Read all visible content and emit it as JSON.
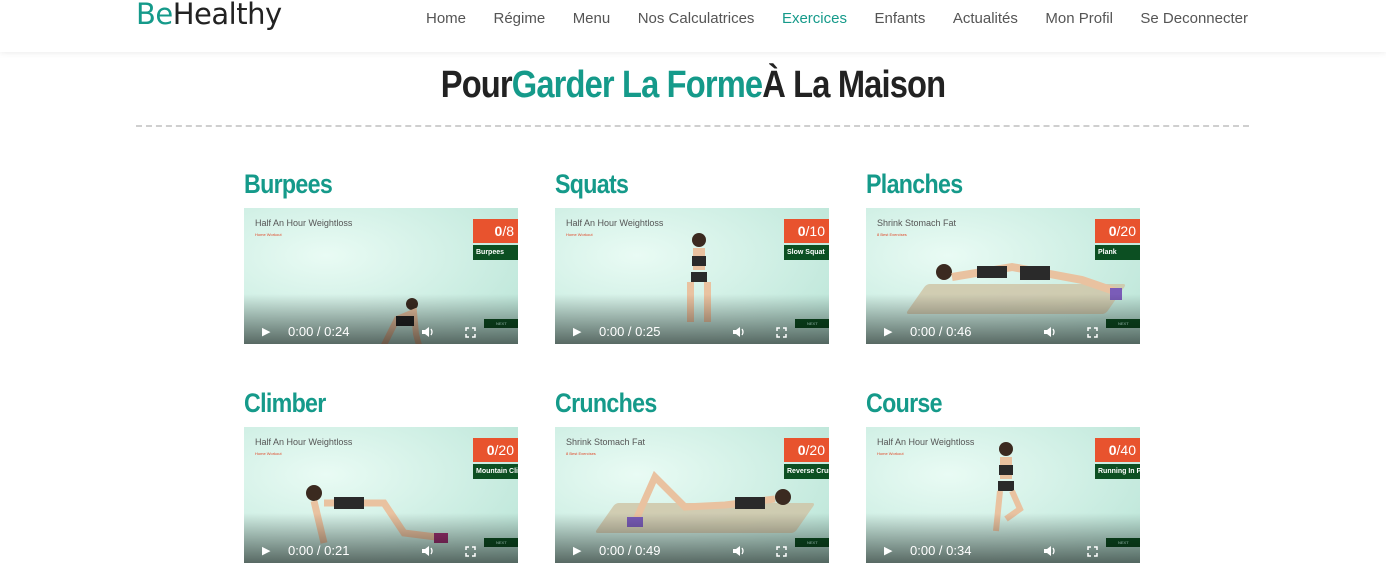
{
  "brand": {
    "prefix": "Be",
    "suffix": "Healthy"
  },
  "nav": [
    "Home",
    "Régime",
    "Menu",
    "Nos Calculatrices",
    "Exercices",
    "Enfants",
    "Actualités",
    "Mon Profil",
    "Se Deconnecter"
  ],
  "active_nav": "Exercices",
  "title": {
    "before": "Pour",
    "accent": "Garder La Forme",
    "after": "À La Maison"
  },
  "colors": {
    "accent": "#159a8a",
    "counter": "#e8532e",
    "label": "#0c4f22"
  },
  "cards": [
    {
      "name": "Burpees",
      "video_title": "Half An Hour Weightloss",
      "video_sub": "Home Workout",
      "count": "0",
      "total": "/8",
      "label": "Burpees",
      "next": "NEXT",
      "time": "0:00 / 0:24"
    },
    {
      "name": "Squats",
      "video_title": "Half An Hour Weightloss",
      "video_sub": "Home Workout",
      "count": "0",
      "total": "/10",
      "label": "Slow Squat",
      "next": "NEXT",
      "time": "0:00 / 0:25"
    },
    {
      "name": "Planches",
      "video_title": "Shrink Stomach Fat",
      "video_sub": "8 Best Exercises",
      "count": "0",
      "total": "/20",
      "label": "Plank",
      "next": "NEXT",
      "time": "0:00 / 0:46"
    },
    {
      "name": "Climber",
      "video_title": "Half An Hour Weightloss",
      "video_sub": "Home Workout",
      "count": "0",
      "total": "/20",
      "label": "Mountain Climb",
      "next": "NEXT",
      "time": "0:00 / 0:21"
    },
    {
      "name": "Crunches",
      "video_title": "Shrink Stomach Fat",
      "video_sub": "8 Best Exercises",
      "count": "0",
      "total": "/20",
      "label": "Reverse Crunch",
      "next": "NEXT",
      "time": "0:00 / 0:49"
    },
    {
      "name": "Course",
      "video_title": "Half An Hour Weightloss",
      "video_sub": "Home Workout",
      "count": "0",
      "total": "/40",
      "label": "Running In Pla",
      "next": "NEXT",
      "time": "0:00 / 0:34"
    }
  ]
}
